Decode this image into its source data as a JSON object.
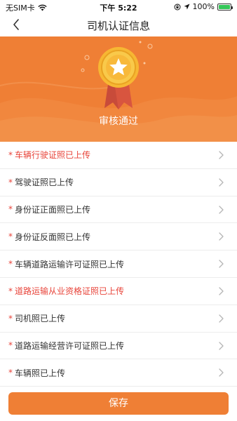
{
  "status_bar": {
    "carrier": "无SIM卡",
    "time": "下午 5:22",
    "battery": "100%"
  },
  "nav": {
    "title": "司机认证信息"
  },
  "hero": {
    "status": "审核通过",
    "color": "#ef7f35"
  },
  "items": [
    {
      "label": "车辆行驶证照已上传",
      "required": "*",
      "highlight": true
    },
    {
      "label": "驾驶证照已上传",
      "required": "*",
      "highlight": false
    },
    {
      "label": "身份证正面照已上传",
      "required": "*",
      "highlight": false
    },
    {
      "label": "身份证反面照已上传",
      "required": "*",
      "highlight": false
    },
    {
      "label": "车辆道路运输许可证照已上传",
      "required": "*",
      "highlight": false
    },
    {
      "label": "道路运输从业资格证照已上传",
      "required": "*",
      "highlight": true
    },
    {
      "label": "司机照已上传",
      "required": "*",
      "highlight": false
    },
    {
      "label": "道路运输经营许可证照已上传",
      "required": "*",
      "highlight": false
    },
    {
      "label": "车辆照已上传",
      "required": "*",
      "highlight": false
    }
  ],
  "save_button": {
    "label": "保存"
  }
}
